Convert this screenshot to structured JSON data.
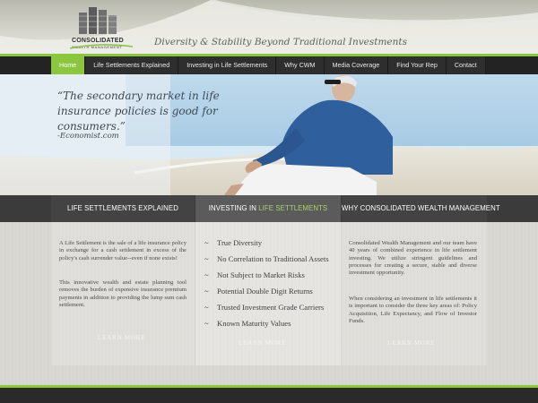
{
  "header": {
    "logo_name": "CONSOLIDATED",
    "logo_sub": "WEALTH MANAGEMENT",
    "tagline": "Diversity & Stability Beyond Traditional Investments"
  },
  "nav": {
    "items": [
      {
        "label": "Home"
      },
      {
        "label": "Life Settlements Explained"
      },
      {
        "label": "Investing in Life Settlements"
      },
      {
        "label": "Why CWM"
      },
      {
        "label": "Media Coverage"
      },
      {
        "label": "Find Your Rep"
      },
      {
        "label": "Contact"
      }
    ],
    "active_index": 0
  },
  "hero": {
    "quote": "“The secondary market in life insurance policies is good for consumers.”",
    "source": "-Economist.com"
  },
  "columns": [
    {
      "heading": "LIFE SETTLEMENTS EXPLAINED",
      "paragraphs": [
        "A Life Settlement is the sale of a life insurance policy in exchange for a cash settlement in excess of the policy's cash surrender value--even if none exists!",
        "This innovative wealth and estate planning tool removes the burden of expensive insurance premium payments in addition to providing the lump sum cash settlement."
      ],
      "learn_more": "LEARN MORE"
    },
    {
      "heading_plain": "INVESTING IN ",
      "heading_accent": "LIFE SETTLEMENTS",
      "list": [
        "True Diversity",
        "No Correlation to Traditional Assets",
        "Not Subject to Market Risks",
        "Potential Double Digit Returns",
        "Trusted Investment Grade Carriers",
        "Known Maturity Values"
      ],
      "bullet": "~",
      "learn_more": "LEARN MORE"
    },
    {
      "heading": "WHY CONSOLIDATED WEALTH MANAGEMENT",
      "paragraphs": [
        "Consolidated Wealth Management and our team have 40 years of combined experience in life settlement investing. We utilize stringent guidelines and processes for creating a secure, stable and diverse investment opportunity.",
        "When considering an investment in life settlements it is important to consider the three key areas of: Policy Acquisition, Life Expectancy, and Flow of Investor Funds."
      ],
      "learn_more": "LEARN MORE"
    }
  ],
  "colors": {
    "accent": "#8cc63f",
    "nav_bg": "#232323",
    "header_bg": "#c9c9bf"
  }
}
